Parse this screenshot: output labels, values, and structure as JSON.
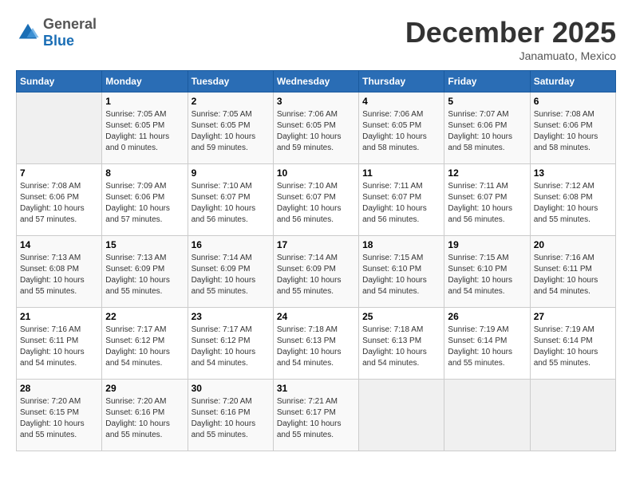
{
  "header": {
    "logo_general": "General",
    "logo_blue": "Blue",
    "month_title": "December 2025",
    "location": "Janamuato, Mexico"
  },
  "days_of_week": [
    "Sunday",
    "Monday",
    "Tuesday",
    "Wednesday",
    "Thursday",
    "Friday",
    "Saturday"
  ],
  "weeks": [
    [
      {
        "day": "",
        "info": ""
      },
      {
        "day": "1",
        "info": "Sunrise: 7:05 AM\nSunset: 6:05 PM\nDaylight: 11 hours\nand 0 minutes."
      },
      {
        "day": "2",
        "info": "Sunrise: 7:05 AM\nSunset: 6:05 PM\nDaylight: 10 hours\nand 59 minutes."
      },
      {
        "day": "3",
        "info": "Sunrise: 7:06 AM\nSunset: 6:05 PM\nDaylight: 10 hours\nand 59 minutes."
      },
      {
        "day": "4",
        "info": "Sunrise: 7:06 AM\nSunset: 6:05 PM\nDaylight: 10 hours\nand 58 minutes."
      },
      {
        "day": "5",
        "info": "Sunrise: 7:07 AM\nSunset: 6:06 PM\nDaylight: 10 hours\nand 58 minutes."
      },
      {
        "day": "6",
        "info": "Sunrise: 7:08 AM\nSunset: 6:06 PM\nDaylight: 10 hours\nand 58 minutes."
      }
    ],
    [
      {
        "day": "7",
        "info": "Sunrise: 7:08 AM\nSunset: 6:06 PM\nDaylight: 10 hours\nand 57 minutes."
      },
      {
        "day": "8",
        "info": "Sunrise: 7:09 AM\nSunset: 6:06 PM\nDaylight: 10 hours\nand 57 minutes."
      },
      {
        "day": "9",
        "info": "Sunrise: 7:10 AM\nSunset: 6:07 PM\nDaylight: 10 hours\nand 56 minutes."
      },
      {
        "day": "10",
        "info": "Sunrise: 7:10 AM\nSunset: 6:07 PM\nDaylight: 10 hours\nand 56 minutes."
      },
      {
        "day": "11",
        "info": "Sunrise: 7:11 AM\nSunset: 6:07 PM\nDaylight: 10 hours\nand 56 minutes."
      },
      {
        "day": "12",
        "info": "Sunrise: 7:11 AM\nSunset: 6:07 PM\nDaylight: 10 hours\nand 56 minutes."
      },
      {
        "day": "13",
        "info": "Sunrise: 7:12 AM\nSunset: 6:08 PM\nDaylight: 10 hours\nand 55 minutes."
      }
    ],
    [
      {
        "day": "14",
        "info": "Sunrise: 7:13 AM\nSunset: 6:08 PM\nDaylight: 10 hours\nand 55 minutes."
      },
      {
        "day": "15",
        "info": "Sunrise: 7:13 AM\nSunset: 6:09 PM\nDaylight: 10 hours\nand 55 minutes."
      },
      {
        "day": "16",
        "info": "Sunrise: 7:14 AM\nSunset: 6:09 PM\nDaylight: 10 hours\nand 55 minutes."
      },
      {
        "day": "17",
        "info": "Sunrise: 7:14 AM\nSunset: 6:09 PM\nDaylight: 10 hours\nand 55 minutes."
      },
      {
        "day": "18",
        "info": "Sunrise: 7:15 AM\nSunset: 6:10 PM\nDaylight: 10 hours\nand 54 minutes."
      },
      {
        "day": "19",
        "info": "Sunrise: 7:15 AM\nSunset: 6:10 PM\nDaylight: 10 hours\nand 54 minutes."
      },
      {
        "day": "20",
        "info": "Sunrise: 7:16 AM\nSunset: 6:11 PM\nDaylight: 10 hours\nand 54 minutes."
      }
    ],
    [
      {
        "day": "21",
        "info": "Sunrise: 7:16 AM\nSunset: 6:11 PM\nDaylight: 10 hours\nand 54 minutes."
      },
      {
        "day": "22",
        "info": "Sunrise: 7:17 AM\nSunset: 6:12 PM\nDaylight: 10 hours\nand 54 minutes."
      },
      {
        "day": "23",
        "info": "Sunrise: 7:17 AM\nSunset: 6:12 PM\nDaylight: 10 hours\nand 54 minutes."
      },
      {
        "day": "24",
        "info": "Sunrise: 7:18 AM\nSunset: 6:13 PM\nDaylight: 10 hours\nand 54 minutes."
      },
      {
        "day": "25",
        "info": "Sunrise: 7:18 AM\nSunset: 6:13 PM\nDaylight: 10 hours\nand 54 minutes."
      },
      {
        "day": "26",
        "info": "Sunrise: 7:19 AM\nSunset: 6:14 PM\nDaylight: 10 hours\nand 55 minutes."
      },
      {
        "day": "27",
        "info": "Sunrise: 7:19 AM\nSunset: 6:14 PM\nDaylight: 10 hours\nand 55 minutes."
      }
    ],
    [
      {
        "day": "28",
        "info": "Sunrise: 7:20 AM\nSunset: 6:15 PM\nDaylight: 10 hours\nand 55 minutes."
      },
      {
        "day": "29",
        "info": "Sunrise: 7:20 AM\nSunset: 6:16 PM\nDaylight: 10 hours\nand 55 minutes."
      },
      {
        "day": "30",
        "info": "Sunrise: 7:20 AM\nSunset: 6:16 PM\nDaylight: 10 hours\nand 55 minutes."
      },
      {
        "day": "31",
        "info": "Sunrise: 7:21 AM\nSunset: 6:17 PM\nDaylight: 10 hours\nand 55 minutes."
      },
      {
        "day": "",
        "info": ""
      },
      {
        "day": "",
        "info": ""
      },
      {
        "day": "",
        "info": ""
      }
    ]
  ]
}
